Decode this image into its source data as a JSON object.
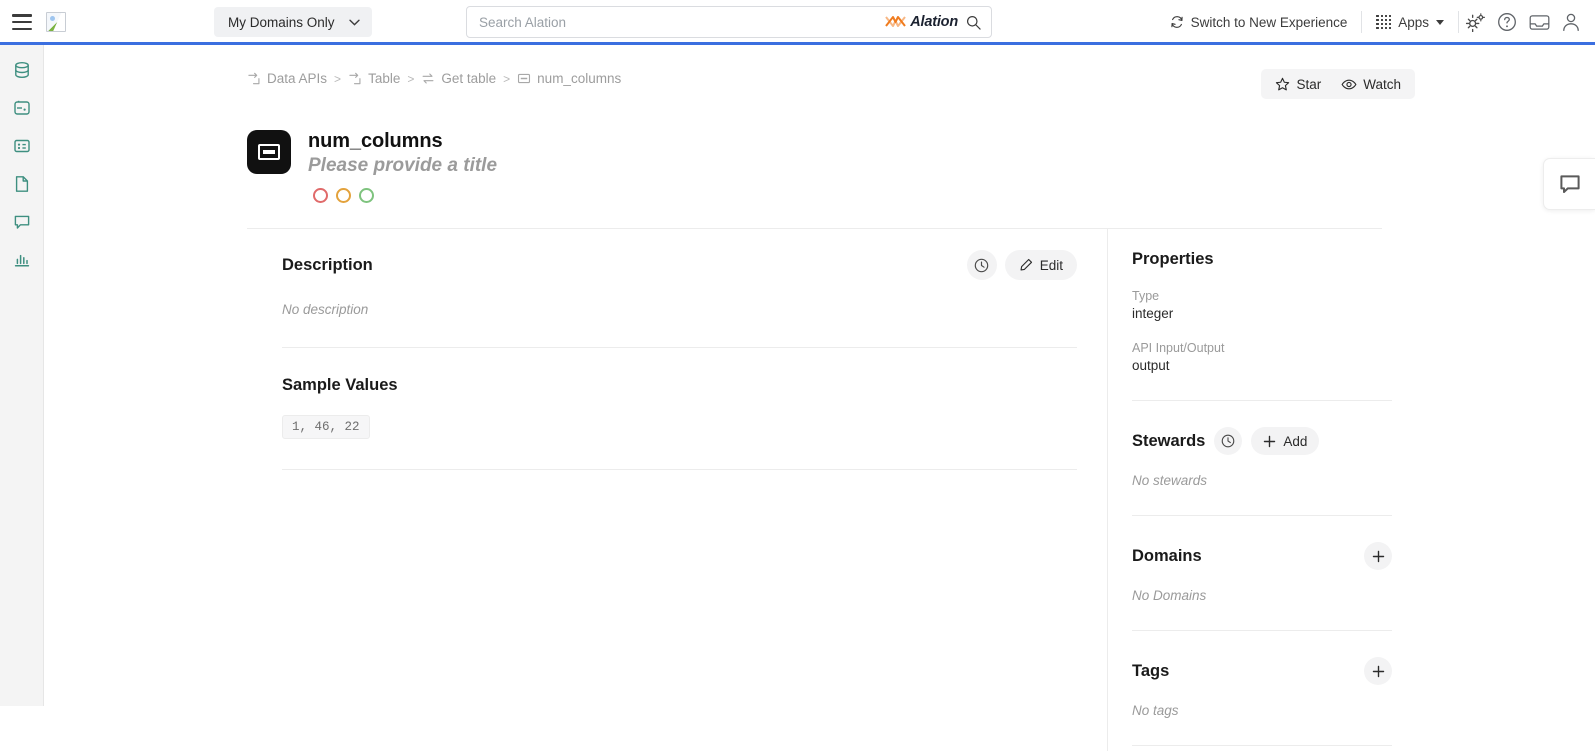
{
  "header": {
    "menu_icon": "hamburger-menu-icon",
    "logo_icon": "broken-image-icon",
    "domain_filter": {
      "label": "My Domains Only",
      "caret": "chevron-down-icon"
    },
    "search": {
      "placeholder": "Search Alation",
      "value": "",
      "brand": "Alation",
      "icon": "search-icon"
    },
    "switch_experience": {
      "label": "Switch to New Experience",
      "icon": "refresh-icon"
    },
    "apps": {
      "label": "Apps",
      "icon": "grid-apps-icon",
      "caret": "caret-down-icon"
    },
    "icons": [
      {
        "name": "settings-gear-icon"
      },
      {
        "name": "help-question-icon"
      },
      {
        "name": "inbox-icon"
      },
      {
        "name": "user-profile-icon"
      }
    ]
  },
  "sidebar": {
    "items": [
      {
        "name": "sidebar-item-sources",
        "icon": "database-icon"
      },
      {
        "name": "sidebar-item-vault",
        "icon": "lock-icon"
      },
      {
        "name": "sidebar-item-catalog",
        "icon": "table-card-icon"
      },
      {
        "name": "sidebar-item-documents",
        "icon": "document-icon"
      },
      {
        "name": "sidebar-item-conversations",
        "icon": "chat-bubble-icon"
      },
      {
        "name": "sidebar-item-analytics",
        "icon": "bar-chart-icon"
      }
    ]
  },
  "breadcrumb": [
    {
      "label": "Data APIs",
      "icon": "api-icon"
    },
    {
      "label": "Table",
      "icon": "api-icon"
    },
    {
      "label": "Get table",
      "icon": "exchange-icon"
    },
    {
      "label": "num_columns",
      "icon": "column-icon"
    }
  ],
  "breadcrumb_separator": ">",
  "actions": {
    "star": {
      "label": "Star",
      "icon": "star-outline-icon"
    },
    "watch": {
      "label": "Watch",
      "icon": "eye-icon"
    }
  },
  "title": {
    "icon": "column-object-icon",
    "name": "num_columns",
    "subtitle": "Please provide a title",
    "flags": [
      {
        "name": "endorsement-flag-deprecation",
        "color": "#e06a6a"
      },
      {
        "name": "endorsement-flag-warning",
        "color": "#e3a23c"
      },
      {
        "name": "endorsement-flag-endorsed",
        "color": "#7ec37e"
      }
    ]
  },
  "description": {
    "title": "Description",
    "history_icon": "clock-history-icon",
    "edit_label": "Edit",
    "edit_icon": "pencil-icon",
    "empty": "No description"
  },
  "sample_values": {
    "title": "Sample Values",
    "value": "1, 46, 22"
  },
  "properties": {
    "title": "Properties",
    "rows": [
      {
        "label": "Type",
        "value": "integer"
      },
      {
        "label": "API Input/Output",
        "value": "output"
      }
    ]
  },
  "stewards": {
    "title": "Stewards",
    "history_icon": "clock-history-icon",
    "add_label": "Add",
    "add_icon": "plus-icon",
    "empty": "No stewards"
  },
  "domains": {
    "title": "Domains",
    "add_icon": "plus-icon",
    "empty": "No Domains"
  },
  "tags": {
    "title": "Tags",
    "add_icon": "plus-icon",
    "empty": "No tags"
  },
  "chat": {
    "icon": "chat-bubble-icon"
  },
  "colors": {
    "accent_blue": "#3b6fe0",
    "brand_orange": "#f07c1f",
    "rail_icon_teal": "#3e8f80"
  }
}
